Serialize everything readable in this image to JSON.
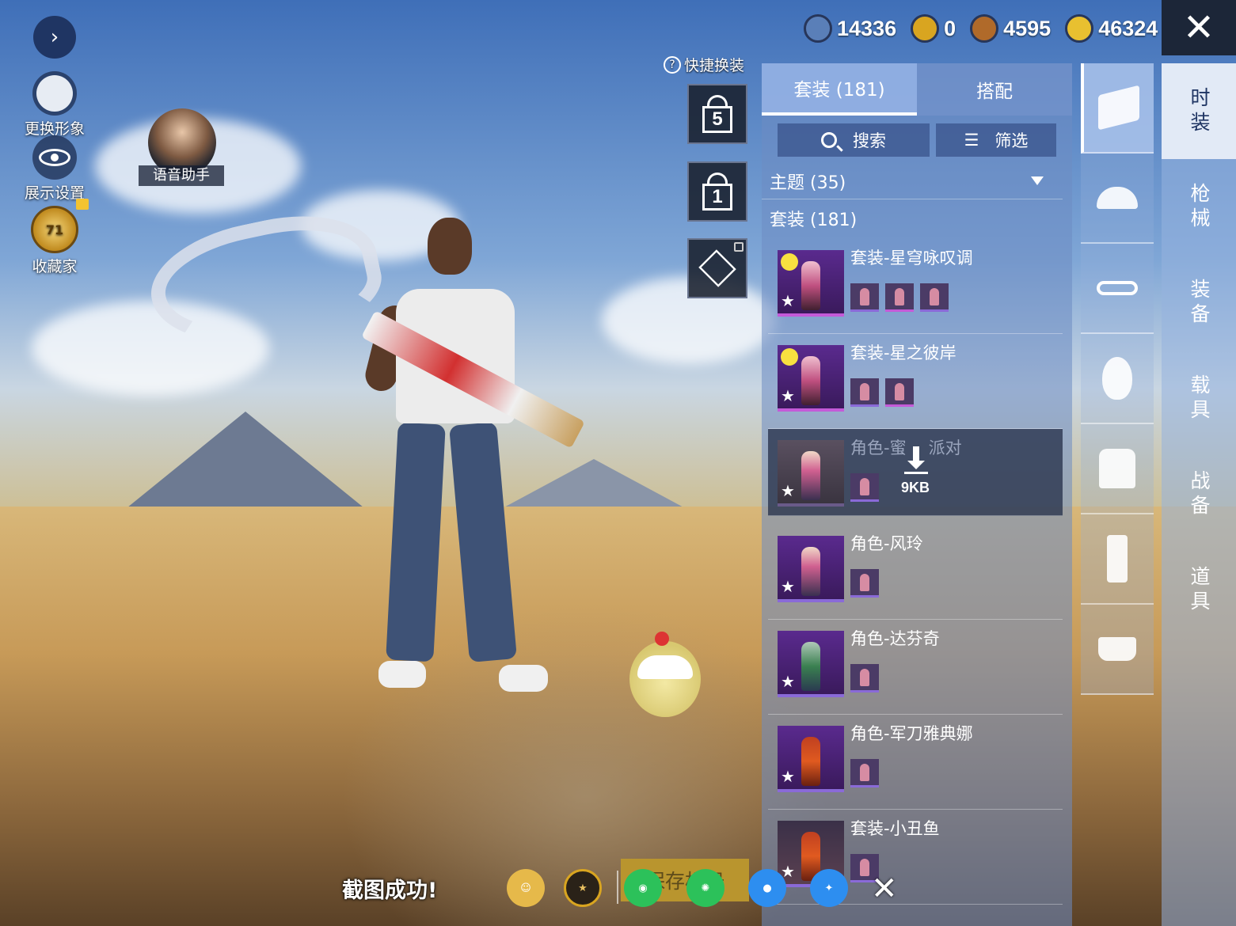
{
  "left_menu": {
    "change_avatar": "更换形象",
    "display_settings": "展示设置",
    "collector": "收藏家",
    "collector_level": "71",
    "voice_assistant": "语音助手"
  },
  "currency": [
    {
      "value": "14336",
      "icon": "blue-coin-icon",
      "color": "#5a7fb8"
    },
    {
      "value": "0",
      "icon": "gold-triangle-coin-icon",
      "color": "#d9a520"
    },
    {
      "value": "4595",
      "icon": "bronze-coin-icon",
      "color": "#b06a2a"
    },
    {
      "value": "46324",
      "icon": "lightning-coin-icon",
      "color": "#e8c030"
    }
  ],
  "quick_outfit": {
    "label": "快捷换装",
    "slot1": "5",
    "slot2": "1"
  },
  "tabs": {
    "outfit": "套装 (181)",
    "match": "搭配"
  },
  "search": {
    "search_label": "搜索",
    "filter_label": "筛选"
  },
  "theme_label": "主题 (35)",
  "set_label": "套装 (181)",
  "items": [
    {
      "name": "套装-星穹咏叹调"
    },
    {
      "name": "套装-星之彼岸"
    },
    {
      "name": "角色-蜜",
      "name_tail": "派对",
      "download_size": "9KB"
    },
    {
      "name": "角色-风玲"
    },
    {
      "name": "角色-达芬奇"
    },
    {
      "name": "角色-军刀雅典娜"
    },
    {
      "name": "套装-小丑鱼"
    }
  ],
  "main_categories": [
    "时装",
    "枪械",
    "装备",
    "载具",
    "战备",
    "道具"
  ],
  "bottom": {
    "screenshot_success": "截图成功!",
    "save_label": "保存相册",
    "share_icons": [
      "profile-share-icon",
      "peace-elite-icon",
      "wechat-icon",
      "moments-icon",
      "qq-icon",
      "qzone-icon"
    ]
  }
}
